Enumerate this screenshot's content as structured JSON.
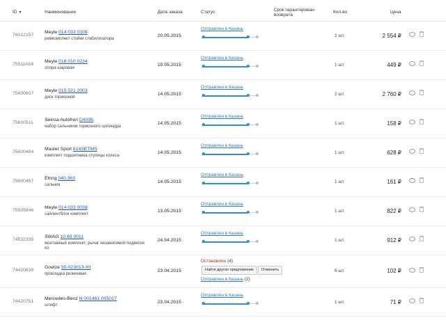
{
  "header": {
    "id": "ID",
    "sort_arrow": "▼",
    "name": "Наименование",
    "date": "Дата заказа",
    "status": "Статус",
    "warranty": "Срок гарантирован-возврата",
    "qty": "Кол-во",
    "price": "Цена"
  },
  "rows": [
    {
      "id": "76012157",
      "brand": "Meyle",
      "code": "014 033 0106",
      "desc": "ремкомплект стойки стабилизатора",
      "date": "20.05.2015",
      "status": "Отправлен в Казань",
      "progress": 0.82,
      "qty": "2 шт.",
      "price": "2 554 ₽"
    },
    {
      "id": "75911434",
      "brand": "Meyle",
      "code": "016 010 0234",
      "desc": "опора шаровая",
      "date": "19.05.2015",
      "status": "Отправлен в Казань",
      "progress": 0.82,
      "qty": "1 шт.",
      "price": "449 ₽"
    },
    {
      "id": "75600607",
      "brand": "Meyle",
      "code": "015 521 2003",
      "desc": "диск тормозной",
      "date": "14.05.2015",
      "status": "Отправлен в Казань",
      "progress": 0.82,
      "qty": "2 шт.",
      "price": "2 760 ₽"
    },
    {
      "id": "75600511",
      "brand": "Seinsa Autofren",
      "code": "D4095",
      "desc": "набор сальников тормозного цилиндра",
      "date": "14.05.2015",
      "status": "Отправлен в Казань",
      "progress": 0.82,
      "qty": "1 шт.",
      "price": "158 ₽"
    },
    {
      "id": "75600484",
      "brand": "Master Sport",
      "code": "614SETMS",
      "desc": "комплект подшипника ступицы колеса",
      "date": "14.05.2015",
      "status": "Отправлен в Казань",
      "progress": 0.82,
      "qty": "1 шт.",
      "price": "628 ₽"
    },
    {
      "id": "75600457",
      "brand": "Elring",
      "code": "040.363",
      "desc": "сальник",
      "date": "14.05.2015",
      "status": "Отправлен в Казань",
      "progress": 0.82,
      "qty": "1 шт.",
      "price": "161 ₽",
      "comment_active": true
    },
    {
      "id": "75505846",
      "brand": "Meyle",
      "code": "014 033 0038",
      "desc": "сайлентблок комплект",
      "date": "13.05.2015",
      "status": "Отправлен в Казань",
      "progress": 0.82,
      "qty": "1 шт.",
      "price": "822 ₽"
    },
    {
      "id": "74532335",
      "brand": "SWAG",
      "code": "10 60 0011",
      "desc": "монтажный комплект, рычаг независимой подвески ко",
      "date": "24.04.2015",
      "status": "Отправлен в Казань",
      "progress": 0.82,
      "qty": "1 шт.",
      "price": "912 ₽"
    },
    {
      "id": "74420839",
      "brand": "Goetze",
      "code": "50-023013-00",
      "desc": "прокладка резиновая",
      "date": "23.04.2015",
      "status_stopped": "Остановлен",
      "stopped_count": "(4)",
      "btn_find": "Найти другое предложение",
      "btn_cancel": "Отменить",
      "status2": "Отправлен в Казань",
      "status2_count": "(2)",
      "qty": "6 шт.",
      "price": "102 ₽"
    },
    {
      "id": "74420751",
      "brand": "Mercedes-Benz",
      "code": "N 001481 005017",
      "desc": "штифт",
      "date": "23.04.2015",
      "status": "Отправлен в Казань",
      "progress": 0.82,
      "qty": "1 шт.",
      "price": "71 ₽"
    }
  ],
  "icons": {
    "comment": "comment-icon",
    "trash": "trash-icon"
  },
  "colors": {
    "link": "#2c7bd0",
    "progress": "#2c8fd6",
    "stopped": "#d02020"
  }
}
